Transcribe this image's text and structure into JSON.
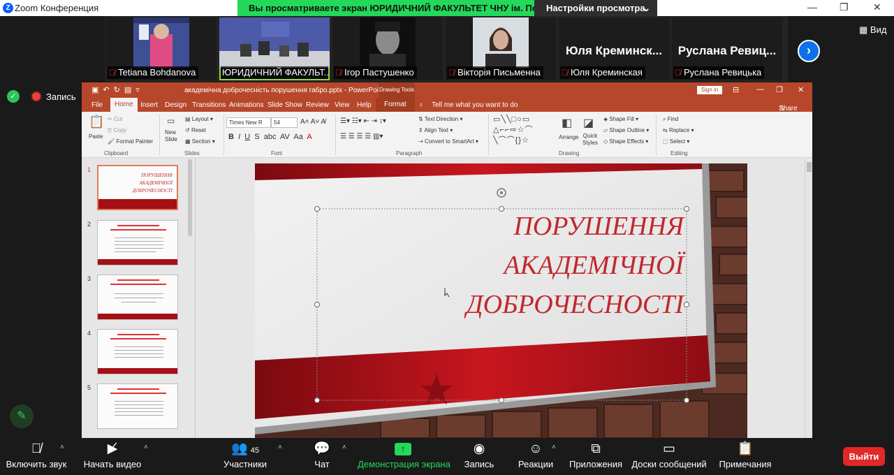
{
  "zoom": {
    "window_title": "Zoom Конференция",
    "share_banner": "Вы просматриваете экран ЮРИДИЧНИЙ ФАКУЛЬТЕТ ЧНУ ім. Пе...",
    "view_options_label": "Настройки просмотра",
    "view_button_label": "Вид",
    "record_label": "Запись",
    "participants": [
      {
        "name": "Tetiana Bohdanova",
        "muted": true,
        "kind": "video"
      },
      {
        "name": "ЮРИДИЧНИЙ ФАКУЛЬТ...",
        "muted": false,
        "kind": "video"
      },
      {
        "name": "Ігор Пастушенко",
        "muted": true,
        "kind": "video"
      },
      {
        "name": "Вікторія Письменна",
        "muted": true,
        "kind": "video"
      },
      {
        "name": "Юля Креминская",
        "display": "Юля Креминск...",
        "muted": true,
        "kind": "name"
      },
      {
        "name": "Руслана Ревицька",
        "display": "Руслана Ревиц...",
        "muted": true,
        "kind": "name"
      }
    ],
    "toolbar": {
      "unmute": "Включить звук",
      "start_video": "Начать видео",
      "participants": "Участники",
      "participants_count": "45",
      "chat": "Чат",
      "share_screen": "Демонстрация экрана",
      "record": "Запись",
      "reactions": "Реакции",
      "apps": "Приложения",
      "whiteboards": "Доски сообщений",
      "notes": "Примечания",
      "leave": "Выйти"
    },
    "colors": {
      "share_green": "#23d959",
      "leave_red": "#e02828",
      "accent_blue": "#0e71eb"
    }
  },
  "ppt": {
    "file_title": "академічна доброчесність порушення габро.pptx  -  PowerPoint",
    "contextual_tab_group": "Drawing Tools",
    "sign_in": "Sign in",
    "share": "Share",
    "tell_me": "Tell me what you want to do",
    "tabs": [
      "File",
      "Home",
      "Insert",
      "Design",
      "Transitions",
      "Animations",
      "Slide Show",
      "Review",
      "View",
      "Help",
      "Format"
    ],
    "ribbon": {
      "paste": "Paste",
      "cut": "Cut",
      "copy": "Copy",
      "format_painter": "Format Painter",
      "clipboard": "Clipboard",
      "new_slide": "New Slide",
      "layout": "Layout",
      "reset": "Reset",
      "section": "Section",
      "slides": "Slides",
      "font_name": "Times New R",
      "font_size": "54",
      "font": "Font",
      "text_direction": "Text Direction",
      "align_text": "Align Text",
      "convert_smartart": "Convert to SmartArt",
      "paragraph": "Paragraph",
      "arrange": "Arrange",
      "quick_styles": "Quick Styles",
      "shape_fill": "Shape Fill",
      "shape_outline": "Shape Outline",
      "shape_effects": "Shape Effects",
      "drawing": "Drawing",
      "find": "Find",
      "replace": "Replace",
      "select": "Select",
      "editing": "Editing"
    },
    "slide_numbers": [
      "1",
      "2",
      "3",
      "4",
      "5"
    ],
    "thumb1_text": "ПОРУШЕННЯ АКАДЕМІЧНОЇ ДОБРОЧЕСНОСТІ",
    "slide_title_lines": [
      "ПОРУШЕННЯ",
      "АКАДЕМІЧНОЇ",
      "ДОБРОЧЕСНОСТІ"
    ],
    "colors": {
      "ppt_orange": "#b7472a",
      "slide_red": "#c1272d"
    }
  }
}
